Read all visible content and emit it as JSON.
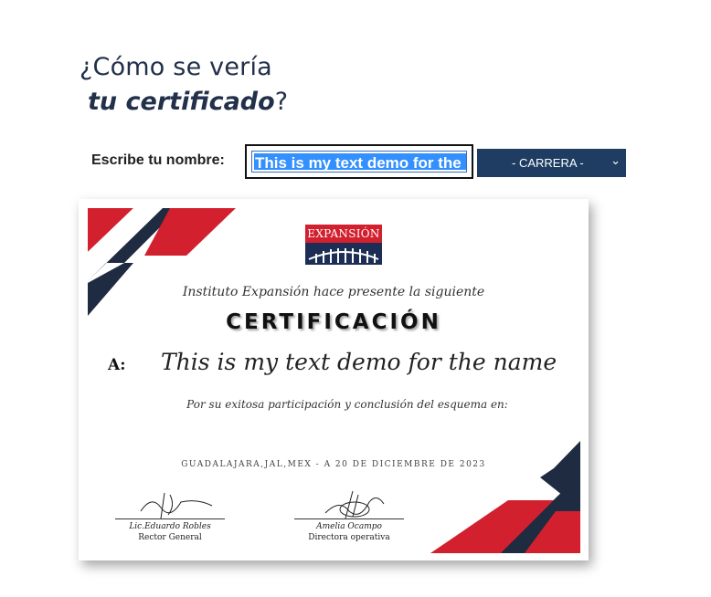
{
  "header": {
    "line1": "¿Cómo se vería",
    "line2_emphasis": "tu certificado",
    "line2_suffix": "?"
  },
  "form": {
    "name_label": "Escribe tu nombre:",
    "name_value": "This is my text demo for the name",
    "career_select": "- CARRERA -"
  },
  "certificate": {
    "logo_text": "EXPANSIÓN",
    "institution_line": "Instituto Expansión hace presente la siguiente",
    "title": "CERTIFICACIÓN",
    "recipient_label": "A:",
    "recipient_name": "This is my text demo for the name",
    "participation_line": "Por su exitosa participación y conclusión del esquema en:",
    "place_date": "GUADALAJARA,JAL,MEX - A 20 DE DICIEMBRE DE 2023",
    "signatures": [
      {
        "name": "Lic.Eduardo Robles",
        "role": "Rector General"
      },
      {
        "name": "Amelia Ocampo",
        "role": "Directora operativa"
      }
    ],
    "colors": {
      "red": "#d3202e",
      "navy": "#1f2b40"
    }
  }
}
